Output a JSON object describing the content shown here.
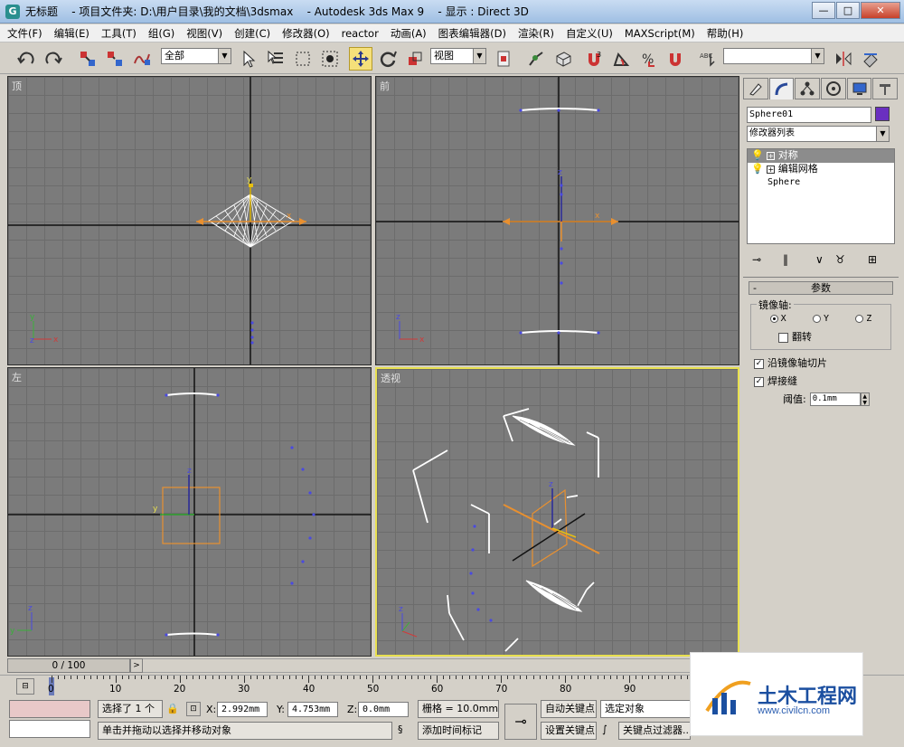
{
  "window": {
    "title": "无标题    - 项目文件夹: D:\\用户目录\\我的文档\\3dsmax    - Autodesk 3ds Max 9    - 显示 : Direct 3D",
    "minimize": "—",
    "maximize": "□",
    "close": "✕"
  },
  "menu": [
    "文件(F)",
    "编辑(E)",
    "工具(T)",
    "组(G)",
    "视图(V)",
    "创建(C)",
    "修改器(O)",
    "reactor",
    "动画(A)",
    "图表编辑器(D)",
    "渲染(R)",
    "自定义(U)",
    "MAXScript(M)",
    "帮助(H)"
  ],
  "toolbar": {
    "selection_filter": "全部",
    "reference_coord": "视图",
    "named_selection": ""
  },
  "viewports": {
    "top": "顶",
    "front": "前",
    "left": "左",
    "perspective": "透视"
  },
  "command_panel": {
    "object_name": "Sphere01",
    "object_color": "#6a2fc0",
    "modifier_list": "修改器列表",
    "stack": [
      "对称",
      "编辑网格",
      "Sphere"
    ],
    "rollout_title": "参数",
    "mirror_axis_label": "镜像轴:",
    "axis_x": "X",
    "axis_y": "Y",
    "axis_z": "Z",
    "flip_label": "翻转",
    "slice_label": "沿镜像轴切片",
    "weld_label": "焊接缝",
    "threshold_label": "阈值:",
    "threshold_value": "0.1mm"
  },
  "timeline": {
    "frame_display": "0 / 100",
    "ticks": [
      "0",
      "10",
      "20",
      "30",
      "40",
      "50",
      "60",
      "70",
      "80",
      "90"
    ]
  },
  "status": {
    "selected": "选择了 1 个",
    "x_label": "X:",
    "x_value": "2.992mm",
    "y_label": "Y:",
    "y_value": "4.753mm",
    "z_label": "Z:",
    "z_value": "0.0mm",
    "grid": "栅格 = 10.0mm",
    "auto_key": "自动关键点",
    "selected_object": "选定对象",
    "set_key": "设置关键点",
    "key_filter": "关键点过滤器...",
    "prompt": "单击并拖动以选择并移动对象",
    "add_time_tag": "添加时间标记"
  },
  "watermark": {
    "title": "土木工程网",
    "url": "www.civilcn.com"
  }
}
